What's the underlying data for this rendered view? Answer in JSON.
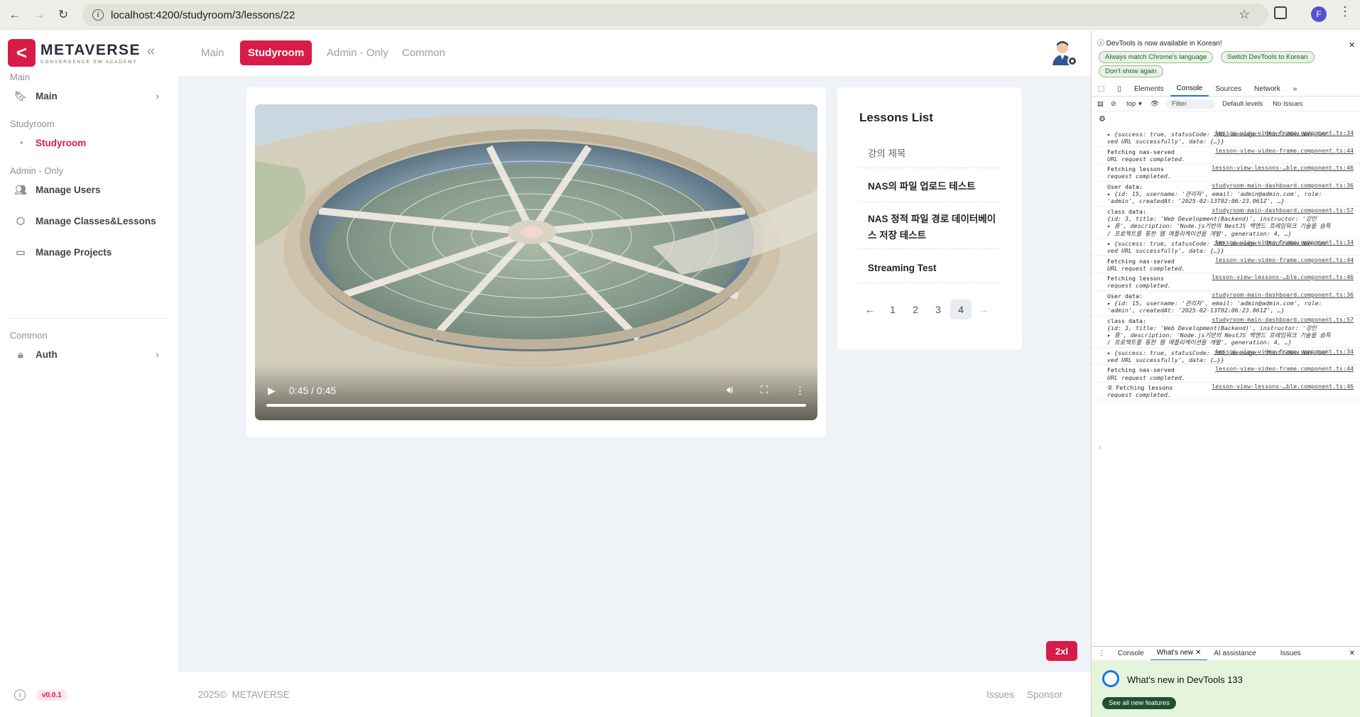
{
  "browser": {
    "url": "localhost:4200/studyroom/3/lessons/22",
    "profile_initial": "F"
  },
  "sidebar": {
    "logo_title": "METAVERSE",
    "logo_sub": "CONVERGENCE SW ACADEMY",
    "sections": {
      "main": "Main",
      "studyroom": "Studyroom",
      "admin": "Admin - Only",
      "common": "Common"
    },
    "items": {
      "main": "Main",
      "studyroom": "Studyroom",
      "manage_users": "Manage Users",
      "manage_classes": "Manage Classes&Lessons",
      "manage_projects": "Manage Projects",
      "auth": "Auth"
    },
    "version": "v0.0.1"
  },
  "topbar": {
    "tabs": [
      "Main",
      "Studyroom",
      "Admin - Only",
      "Common"
    ],
    "active_tab": "Studyroom"
  },
  "video": {
    "time": "0:45 / 0:45",
    "progress": 1.0
  },
  "lessons": {
    "title": "Lessons List",
    "items": [
      "강의 제목",
      "NAS의 파일 업로드 테스트",
      "NAS 정적 파일 경로 데이터베이스 저장 테스트",
      "Streaming Test"
    ],
    "pages": [
      "1",
      "2",
      "3",
      "4"
    ],
    "current_page": "4",
    "prev": "←",
    "next": "→"
  },
  "footer": {
    "copyright": "2025©",
    "brand": "METAVERSE",
    "issues": "Issues",
    "sponsor": "Sponsor"
  },
  "size_badge": "2xl",
  "devtools": {
    "notice": "DevTools is now available in Korean!",
    "btn_match": "Always match Chrome's language",
    "btn_switch": "Switch DevTools to Korean",
    "btn_dont": "Don't show again",
    "tabs": [
      "Elements",
      "Console",
      "Sources",
      "Network"
    ],
    "context": "top",
    "filter": "Filter",
    "levels": "Default levels",
    "issues": "No Issues",
    "logs": [
      {
        "src": "lesson-view-video-frame.component.ts:34",
        "l1": "▸ {success: true, statusCode: 200, message: 'Published Nas-Ser",
        "l2": "ved URL successfully', data: {…}}"
      },
      {
        "src": "lesson-view-video-frame.component.ts:44",
        "l1": "Fetching nas-served",
        "l2": "URL request completed."
      },
      {
        "src": "lesson-view-lessons-…ble.component.ts:46",
        "l1": "Fetching lessons",
        "l2": "request completed."
      },
      {
        "src": "studyroom-main-dashboard.component.ts:36",
        "l1": "User data:",
        "l2": "▸ {id: 15, username: '관리자', email: 'admin@admin.com', role:",
        "l3": "'admin', createdAt: '2025-02-13T02:06:23.061Z', …}"
      },
      {
        "src": "studyroom-main-dashboard.component.ts:57",
        "l1": "class data:",
        "l2": "{id: 3, title: 'Web Development(Backend)', instructor: '강민",
        "l3": "▸ 용', description: 'Node.js기반의 NestJS 백엔드 프레임워크 기술을 습득",
        "l4": "/ 프로젝트를 통한 웹 애플리케이션을 개발', generation: 4, …}"
      },
      {
        "src": "lesson-view-video-frame.component.ts:34",
        "l1": "▸ {success: true, statusCode: 200, message: 'Published Nas-Ser",
        "l2": "ved URL successfully', data: {…}}"
      },
      {
        "src": "lesson-view-video-frame.component.ts:44",
        "l1": "Fetching nas-served",
        "l2": "URL request completed."
      },
      {
        "src": "lesson-view-lessons-…ble.component.ts:46",
        "l1": "Fetching lessons",
        "l2": "request completed."
      },
      {
        "src": "studyroom-main-dashboard.component.ts:36",
        "l1": "User data:",
        "l2": "▸ {id: 15, username: '관리자', email: 'admin@admin.com', role:",
        "l3": "'admin', createdAt: '2025-02-13T02:06:23.061Z', …}"
      },
      {
        "src": "studyroom-main-dashboard.component.ts:57",
        "l1": "class data:",
        "l2": "{id: 3, title: 'Web Development(Backend)', instructor: '강민",
        "l3": "▸ 용', description: 'Node.js기반의 NestJS 백엔드 프레임워크 기술을 습득",
        "l4": "/ 프로젝트를 통한 웹 애플리케이션을 개발', generation: 4, …}"
      },
      {
        "src": "lesson-view-video-frame.component.ts:34",
        "l1": "▸ {success: true, statusCode: 200, message: 'Published Nas-Ser",
        "l2": "ved URL successfully', data: {…}}"
      },
      {
        "src": "lesson-view-video-frame.component.ts:44",
        "l1": "Fetching nas-served",
        "l2": "URL request completed."
      },
      {
        "src": "lesson-view-lessons-…ble.component.ts:46",
        "l1": "② Fetching lessons",
        "l2": "request completed."
      }
    ],
    "drawer_tabs": [
      "Console",
      "What's new",
      "AI assistance",
      "Issues"
    ],
    "whats_new_title": "What's new in DevTools 133",
    "whats_new_btn": "See all new features"
  },
  "colors": {
    "accent": "#d81b48",
    "content_bg": "#eff2f6"
  }
}
